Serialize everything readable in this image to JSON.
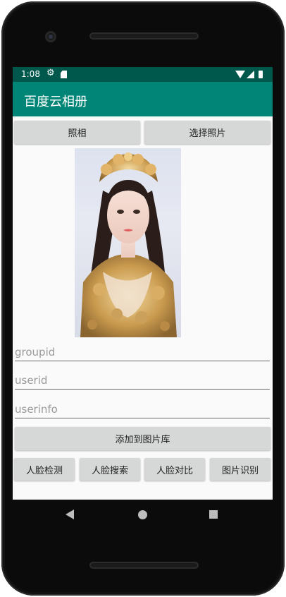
{
  "status_bar": {
    "time": "1:08"
  },
  "app_bar": {
    "title": "百度云相册"
  },
  "buttons": {
    "take_photo": "照相",
    "choose_photo": "选择照片",
    "add_to_library": "添加到图片库",
    "face_detect": "人脸检测",
    "face_search": "人脸搜索",
    "face_compare": "人脸对比",
    "image_recognize": "图片识别"
  },
  "fields": {
    "groupid": {
      "value": "",
      "placeholder": "groupid"
    },
    "userid": {
      "value": "",
      "placeholder": "userid"
    },
    "userinfo": {
      "value": "",
      "placeholder": "userinfo"
    }
  },
  "colors": {
    "status_bar": "#00574b",
    "app_bar": "#008577",
    "button_bg": "#d6d7d7",
    "screen_bg": "#fafafa"
  },
  "icons": [
    "settings-gear-icon",
    "sd-card-icon",
    "wifi-icon",
    "signal-icon",
    "battery-icon",
    "nav-back-icon",
    "nav-home-icon",
    "nav-recents-icon"
  ]
}
